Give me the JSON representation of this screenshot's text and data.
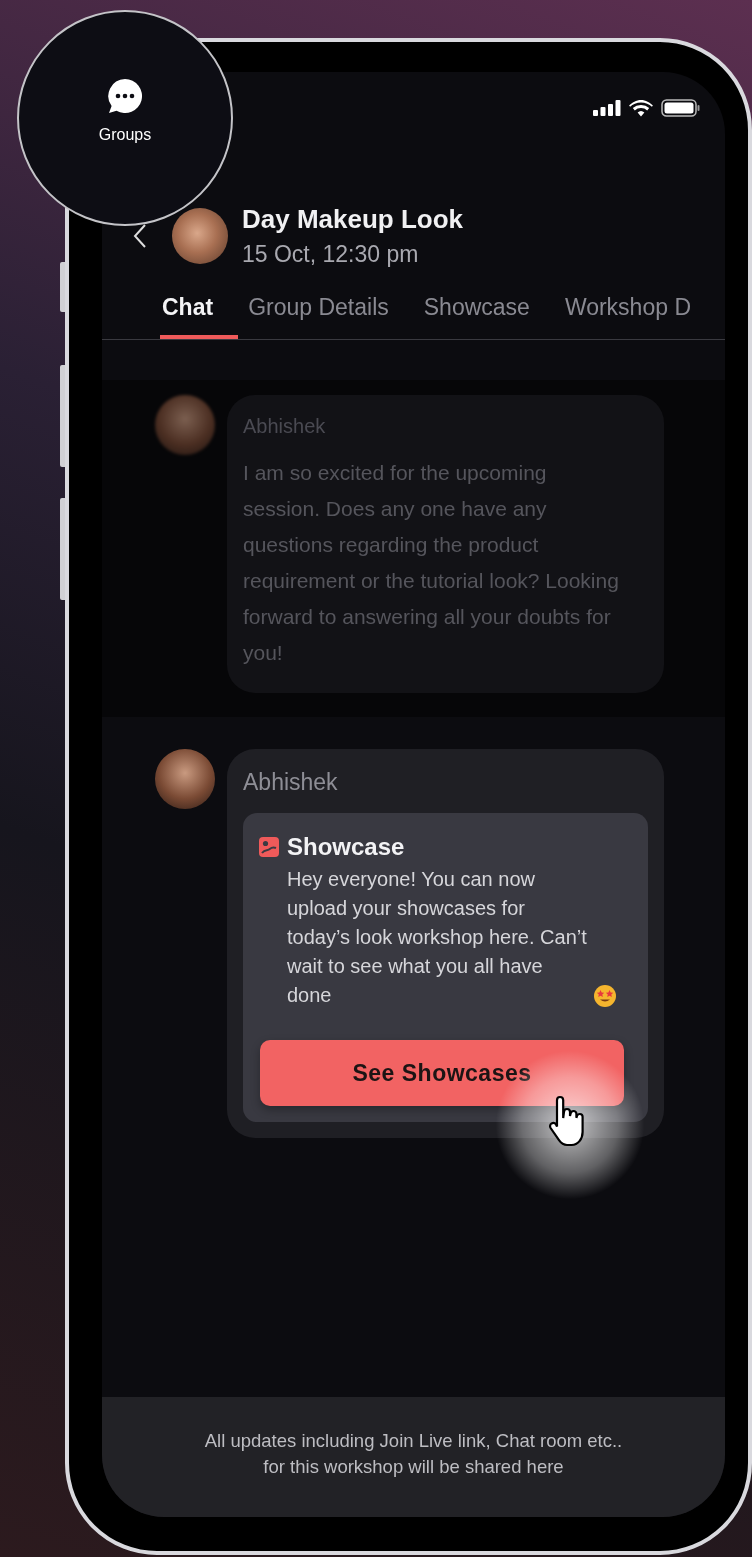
{
  "loupe": {
    "label": "Groups"
  },
  "header": {
    "title": "Day Makeup Look",
    "subtitle": "15 Oct, 12:30 pm"
  },
  "tabs": [
    {
      "label": "Chat",
      "selected": true
    },
    {
      "label": "Group Details",
      "selected": false
    },
    {
      "label": "Showcase",
      "selected": false
    },
    {
      "label": "Workshop D",
      "selected": false
    }
  ],
  "messages": [
    {
      "kind": "text",
      "blurred": true,
      "sender": "Abhishek",
      "text": "I am so excited for the upcoming session. Does any one have any questions regarding the product requirement or the tutorial look? Looking forward to answering all your doubts for you!"
    },
    {
      "kind": "card",
      "blurred": false,
      "sender": "Abhishek",
      "card": {
        "title": "Showcase",
        "text": "Hey everyone! You can now upload your showcases for today’s look workshop here. Can’t wait to see what you all have done",
        "button": "See Showcases"
      }
    }
  ],
  "footer": "All updates including Join Live link, Chat room etc..\nfor this workshop will be shared here"
}
